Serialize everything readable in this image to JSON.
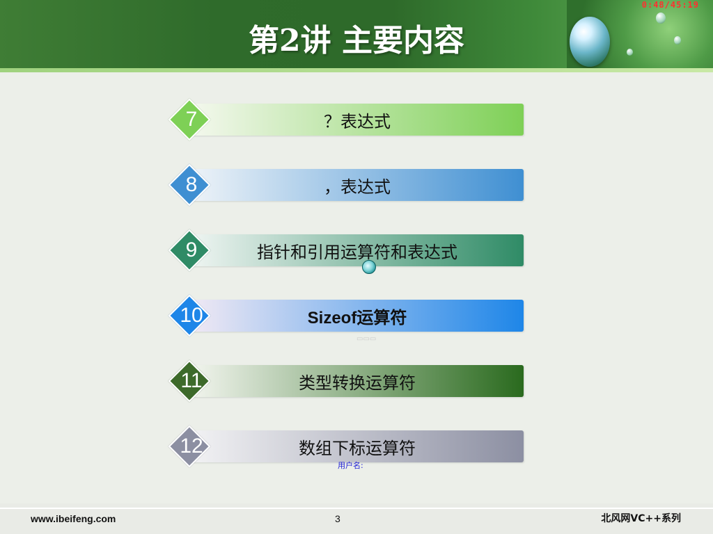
{
  "header": {
    "title": "第2讲 主要内容",
    "timer": "0:48/45:19"
  },
  "items": [
    {
      "number": "7",
      "label": "？表达式",
      "diamond_color": "#7ed056",
      "bar_gradient": [
        "#f4f8ee",
        "#7ed056"
      ]
    },
    {
      "number": "8",
      "label": "，表达式",
      "diamond_color": "#3f8fd2",
      "bar_gradient": [
        "#eef3f8",
        "#3f8fd2"
      ]
    },
    {
      "number": "9",
      "label": "指针和引用运算符和表达式",
      "diamond_color": "#2f8b66",
      "bar_gradient": [
        "#eff5f2",
        "#2f8b66"
      ]
    },
    {
      "number": "10",
      "label": "Sizeof运算符",
      "diamond_color": "#1e86e8",
      "bar_gradient": [
        "#f1e9f4",
        "#1e86e8"
      ]
    },
    {
      "number": "11",
      "label": "类型转换运算符",
      "diamond_color": "#3d6a2a",
      "bar_gradient": [
        "#f2f5ee",
        "#2a6a1e"
      ]
    },
    {
      "number": "12",
      "label": "数组下标运算符",
      "diamond_color": "#8c8fa2",
      "bar_gradient": [
        "#f2f2f4",
        "#8c8fa2"
      ]
    }
  ],
  "overlay": {
    "username_label": "用户名:"
  },
  "footer": {
    "url": "www.ibeifeng.com",
    "page_number": "3",
    "brand": "北风网VC++系列"
  }
}
